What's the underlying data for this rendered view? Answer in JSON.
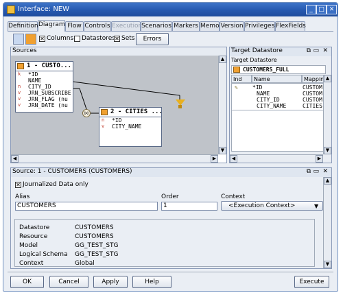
{
  "window": {
    "title": "Interface: NEW"
  },
  "tabs": [
    {
      "label": "Definition"
    },
    {
      "label": "Diagram"
    },
    {
      "label": "Flow"
    },
    {
      "label": "Controls"
    },
    {
      "label": "Execution"
    },
    {
      "label": "Scenarios"
    },
    {
      "label": "Markers"
    },
    {
      "label": "Memo"
    },
    {
      "label": "Version"
    },
    {
      "label": "Privileges"
    },
    {
      "label": "FlexFields"
    }
  ],
  "toolbar": {
    "columns_label": "Columns",
    "columns_checked": true,
    "datastores_label": "Datastores",
    "datastores_checked": false,
    "sets_label": "Sets",
    "sets_checked": true,
    "errors_label": "Errors"
  },
  "sources": {
    "title": "Sources",
    "node1": {
      "title": "1 - CUSTO...",
      "rows": [
        {
          "tag": "k",
          "text": "*ID"
        },
        {
          "tag": "",
          "text": "NAME"
        },
        {
          "tag": "n",
          "text": "CITY_ID"
        },
        {
          "tag": "v",
          "text": "JRN_SUBSCRIBE"
        },
        {
          "tag": "v",
          "text": "JRN_FLAG (nu"
        },
        {
          "tag": "v",
          "text": "JRN_DATE (nu"
        }
      ]
    },
    "node2": {
      "title": "2 - CITIES ...",
      "rows": [
        {
          "tag": "n",
          "text": "*ID"
        },
        {
          "tag": "v",
          "text": "CITY_NAME"
        }
      ]
    }
  },
  "target": {
    "panel_title": "Target Datastore",
    "subtitle": "Target Datastore",
    "name": "CUSTOMERS_FULL",
    "columns": {
      "ind": "Ind",
      "name": "Name",
      "mapping": "Mapping"
    },
    "rows": [
      {
        "name": "*ID",
        "mapping": "CUSTOM"
      },
      {
        "name": "NAME",
        "mapping": "CUSTOM"
      },
      {
        "name": "CITY_ID",
        "mapping": "CUSTOM"
      },
      {
        "name": "CITY_NAME",
        "mapping": "CITIES."
      }
    ]
  },
  "source_panel": {
    "title": "Source: 1 - CUSTOMERS (CUSTOMERS)",
    "journalized_label": "Journalized Data only",
    "journalized_checked": true,
    "alias_label": "Alias",
    "alias_value": "CUSTOMERS",
    "order_label": "Order",
    "order_value": "1",
    "context_label": "Context",
    "context_value": "<Execution Context>",
    "props": [
      {
        "key": "Datastore",
        "value": "CUSTOMERS"
      },
      {
        "key": "Resource",
        "value": "CUSTOMERS"
      },
      {
        "key": "Model",
        "value": "GG_TEST_STG"
      },
      {
        "key": "Logical Schema",
        "value": "GG_TEST_STG"
      },
      {
        "key": "Context",
        "value": "Global"
      }
    ]
  },
  "footer": {
    "ok": "OK",
    "cancel": "Cancel",
    "apply": "Apply",
    "help": "Help",
    "execute": "Execute"
  }
}
